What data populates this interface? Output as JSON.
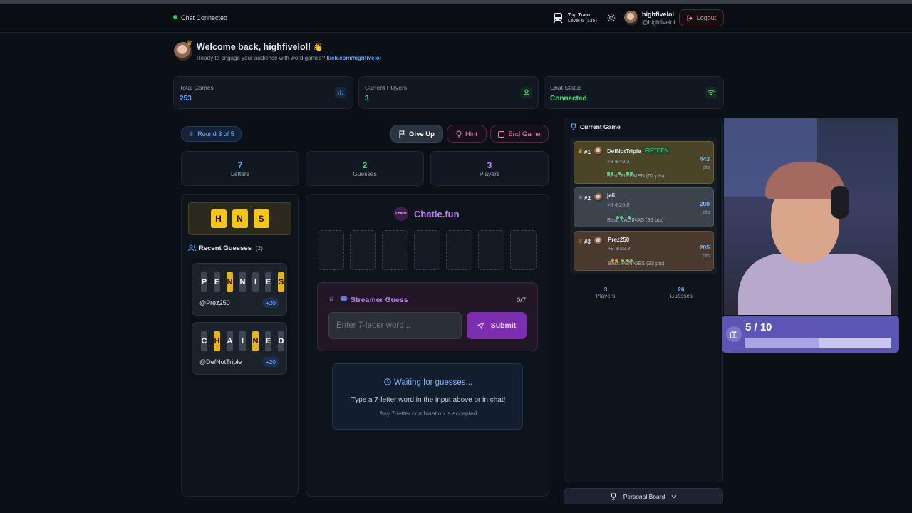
{
  "header": {
    "chat_status": "Chat Connected",
    "train_title": "Top Train",
    "train_level": "Level 6",
    "train_count": "(135)",
    "username": "highfivelol",
    "handle": "@highfivelol",
    "logout_label": "Logout"
  },
  "welcome": {
    "title": "Welcome back, highfivelol!",
    "emoji": "👋",
    "subtitle": "Ready to engage your audience with word games?",
    "link": "kick.com/highfivelol"
  },
  "stats": [
    {
      "label": "Total Games",
      "value": "253",
      "color": "#4fa3ff"
    },
    {
      "label": "Current Players",
      "value": "3",
      "color": "#4ade80"
    },
    {
      "label": "Chat Status",
      "value": "Connected",
      "color": "#4ade80"
    }
  ],
  "round": {
    "label": "Round 3 of 5"
  },
  "actions": {
    "give_up": "Give Up",
    "hint": "Hint",
    "end_game": "End Game"
  },
  "counters": [
    {
      "value": "7",
      "label": "Letters",
      "color": "#60a5fa"
    },
    {
      "value": "2",
      "label": "Guesses",
      "color": "#4ade80"
    },
    {
      "value": "3",
      "label": "Players",
      "color": "#c084fc"
    }
  ],
  "revealed_letters": [
    "H",
    "N",
    "S"
  ],
  "recent": {
    "title": "Recent Guesses",
    "count": "(2)",
    "guesses": [
      {
        "letters": [
          "P",
          "E",
          "N",
          "N",
          "I",
          "E",
          "S"
        ],
        "yellow": [
          2,
          6
        ],
        "user": "@Prez250",
        "points": "+20"
      },
      {
        "letters": [
          "C",
          "H",
          "A",
          "I",
          "N",
          "E",
          "D"
        ],
        "yellow": [
          1,
          4
        ],
        "user": "@DefNotTriple",
        "points": "+20"
      }
    ]
  },
  "brand": {
    "logo_text": "Chatle",
    "name": "Chatle.fun"
  },
  "streamer": {
    "title": "Streamer Guess",
    "count": "0/7",
    "placeholder": "Enter 7-letter word...",
    "submit": "Submit"
  },
  "waiting": {
    "title": "Waiting for guesses...",
    "line1": "Type a 7-letter word in the input above or in chat!",
    "line2": "Any 7-letter combination is accepted"
  },
  "current_game": {
    "title": "Current Game",
    "players": [
      {
        "rank": "#1",
        "name": "DefNotTriple",
        "tag": "FIFTEEN",
        "stats": "+9 ⊕49.2",
        "best": "Best: FIREMEN (52 pts)",
        "points": "443",
        "unit": "pts"
      },
      {
        "rank": "#2",
        "name": "jeli",
        "tag": "",
        "stats": "+8 ⊕26.0",
        "best": "Best: VAGINAS (39 pts)",
        "points": "208",
        "unit": "pts"
      },
      {
        "rank": "#3",
        "name": "Prez250",
        "tag": "",
        "stats": "+9 ⊕22.8",
        "best": "Best: PENNIES (33 pts)",
        "points": "205",
        "unit": "pts"
      }
    ],
    "summary": [
      {
        "value": "3",
        "label": "Players"
      },
      {
        "value": "26",
        "label": "Guesses"
      }
    ]
  },
  "personal_board": "Personal Board",
  "goal": {
    "text": "5 / 10",
    "progress": 0.5
  }
}
